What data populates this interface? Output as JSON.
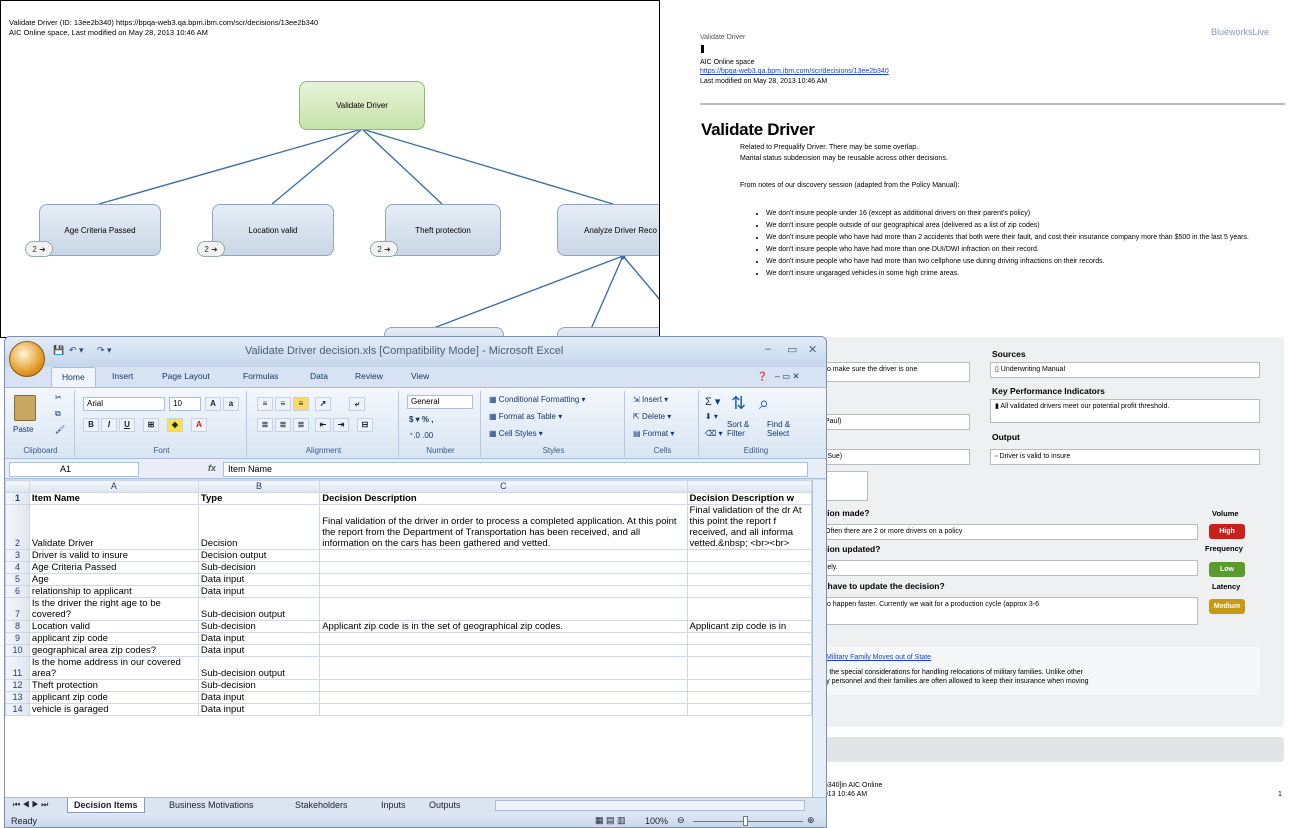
{
  "tree": {
    "header_line1": "Validate Driver (ID: 13ee2b340) https://bpqa-web3.qa.bpm.ibm.com/scr/decisions/13ee2b340",
    "header_line2": "AIC Online space, Last modified on May 28, 2013 10:46 AM",
    "root": "Validate Driver",
    "children": [
      {
        "label": "Age Criteria Passed",
        "badge": "2 ➜"
      },
      {
        "label": "Location valid",
        "badge": "2 ➜"
      },
      {
        "label": "Theft protection",
        "badge": "2 ➜"
      },
      {
        "label": "Analyze Driver Reco",
        "badge": ""
      }
    ]
  },
  "doc": {
    "crumb": "Validate Driver",
    "space": "AIC Online space",
    "url": "https://bpqa-web3.qa.bpm.ibm.com/scr/decisions/13ee2b340",
    "modified": "Last modified on May 28, 2013 10:46 AM",
    "brand": "BlueworksLive",
    "title": "Validate Driver",
    "intro1": "Related to Prequalify Driver. There may be some overlap.",
    "intro2": "Marital status subdecision may be reusable across other decisions.",
    "intro3": "From notes of our discovery session (adapted from the Policy Manual):",
    "bullets": [
      "We don't insure people under 16 (except as additional drivers on their parent's policy)",
      "We don't insure people outside of our geographical area (delivered as a list of zip codes)",
      "We don't insure people who have had more than 2 accidents that both were their fault, and cost their insurance company more than $500 in the last 5 years.",
      "We don't insure people who have had more than one DUI/DWI infraction on their record.",
      "We don't insure people who have had more than two cellphone use during driving infractions on their records.",
      "We don't insure ungaraged vehicles in some high crime areas."
    ],
    "form": {
      "purpose_frag": "to make sure the driver is one",
      "owner_frag": "Paul)",
      "sme_frag": "(Sue)",
      "r_frag": "r",
      "sources_label": "Sources",
      "sources_item": "Underwriting Manual",
      "kpi_label": "Key Performance Indicators",
      "kpi_item": "All validated drivers meet our potential profit threshold.",
      "output_label": "Output",
      "output_item": "Driver is valid to insure",
      "q1": "ision made?",
      "a1": "Often there are 2 or more drivers on a policy",
      "q2": "ision updated?",
      "a2": "rely.",
      "q3": "o have to update the decision?",
      "a3": "to happen faster. Currently we wait for a production cycle (approx 3-6",
      "volume_label": "Volume",
      "volume_val": "High",
      "frequency_label": "Frequency",
      "frequency_val": "Low",
      "latency_label": "Latency",
      "latency_val": "Medium",
      "link": "Military Family Moves out of State",
      "link_text1": "es the special considerations for handling relocations of military families. Unlike other",
      "link_text2": "ary personnel and their families are often allowed to keep their insurance when moving",
      "footer1": "2b340]in AIC Online",
      "footer2": "2013 10:46 AM",
      "footer_page": "1"
    }
  },
  "excel": {
    "title": "Validate Driver decision.xls  [Compatibility Mode] - Microsoft Excel",
    "tabs": [
      "Home",
      "Insert",
      "Page Layout",
      "Formulas",
      "Data",
      "Review",
      "View"
    ],
    "ribbon": {
      "paste": "Paste",
      "clipboard": "Clipboard",
      "font_name": "Arial",
      "font_size": "10",
      "font": "Font",
      "alignment": "Alignment",
      "number_format": "General",
      "number": "Number",
      "cond_fmt": "Conditional Formatting",
      "fmt_table": "Format as Table",
      "cell_styles": "Cell Styles",
      "styles": "Styles",
      "insert": "Insert",
      "delete": "Delete",
      "format": "Format",
      "cells": "Cells",
      "sort_filter": "Sort & Filter",
      "find_select": "Find & Select",
      "editing": "Editing"
    },
    "name_box": "A1",
    "formula": "Item Name",
    "columns": [
      "A",
      "B",
      "C",
      ""
    ],
    "rows": [
      [
        "1",
        "Item Name",
        "Type",
        "Decision Description",
        "Decision Description w"
      ],
      [
        "2",
        "Validate Driver",
        "Decision",
        "Final validation of the driver in order to process a completed application. At this point the report from the Department of Transportation has been received, and all information on the cars has been gathered and vetted.",
        "Final validation of the dr At this point the report f received, and all informa vetted.&nbsp; <br><br>"
      ],
      [
        "3",
        "Driver is valid to insure",
        "Decision output",
        "",
        ""
      ],
      [
        "4",
        "Age Criteria Passed",
        "Sub-decision",
        "",
        ""
      ],
      [
        "5",
        "Age",
        "Data input",
        "",
        ""
      ],
      [
        "6",
        "relationship to applicant",
        "Data input",
        "",
        ""
      ],
      [
        "7",
        "Is the driver the right age to be covered?",
        "Sub-decision output",
        "",
        ""
      ],
      [
        "8",
        "Location valid",
        "Sub-decision",
        "Applicant zip code is in the set of geographical zip codes.",
        "Applicant zip code is in"
      ],
      [
        "9",
        "applicant zip code",
        "Data input",
        "",
        ""
      ],
      [
        "10",
        "geographical area zip codes?",
        "Data input",
        "",
        ""
      ],
      [
        "11",
        "Is the home address in our covered area?",
        "Sub-decision output",
        "",
        ""
      ],
      [
        "12",
        "Theft protection",
        "Sub-decision",
        "",
        ""
      ],
      [
        "13",
        "applicant zip code",
        "Data input",
        "",
        ""
      ],
      [
        "14",
        "vehicle is garaged",
        "Data input",
        "",
        ""
      ]
    ],
    "sheet_tabs": [
      "Decision Items",
      "Business Motivations",
      "Stakeholders",
      "Inputs",
      "Outputs"
    ],
    "status_left": "Ready",
    "zoom": "100%"
  }
}
